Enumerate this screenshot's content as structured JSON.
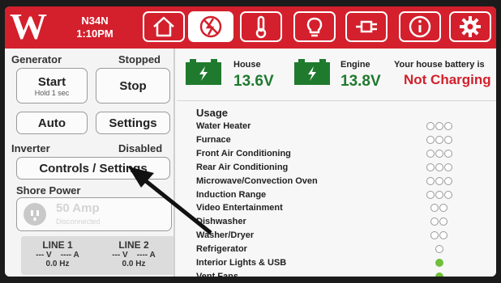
{
  "header": {
    "unit_id": "N34N",
    "time": "1:10PM",
    "nav": [
      {
        "icon": "home-icon"
      },
      {
        "icon": "power-icon"
      },
      {
        "icon": "thermometer-icon"
      },
      {
        "icon": "lightbulb-icon"
      },
      {
        "icon": "plug-icon"
      },
      {
        "icon": "info-icon"
      },
      {
        "icon": "gear-icon"
      }
    ],
    "active_nav": 1
  },
  "generator": {
    "label": "Generator",
    "status": "Stopped",
    "start_label": "Start",
    "start_hint": "Hold 1 sec",
    "stop_label": "Stop",
    "auto_label": "Auto",
    "settings_label": "Settings"
  },
  "inverter": {
    "label": "Inverter",
    "status": "Disabled",
    "controls_label": "Controls / Settings"
  },
  "shore_power": {
    "label": "Shore Power",
    "amps": "50 Amp",
    "status": "Disconnected"
  },
  "lines": [
    {
      "name": "LINE 1",
      "reading": "--- V    ---- A",
      "freq": "0.0 Hz"
    },
    {
      "name": "LINE 2",
      "reading": "--- V    ---- A",
      "freq": "0.0 Hz"
    }
  ],
  "batteries": {
    "house_label": "House",
    "house_voltage": "13.6V",
    "engine_label": "Engine",
    "engine_voltage": "13.8V",
    "message": "Your house battery is",
    "charge_status": "Not Charging",
    "accent_color": "#d3202c",
    "battery_color": "#1f7a2e"
  },
  "usage": {
    "title": "Usage",
    "items": [
      {
        "name": "Water Heater",
        "levels": 3,
        "active": 0
      },
      {
        "name": "Furnace",
        "levels": 3,
        "active": 0
      },
      {
        "name": "Front Air Conditioning",
        "levels": 3,
        "active": 0
      },
      {
        "name": "Rear Air Conditioning",
        "levels": 3,
        "active": 0
      },
      {
        "name": "Microwave/Convection Oven",
        "levels": 3,
        "active": 0
      },
      {
        "name": "Induction Range",
        "levels": 3,
        "active": 0
      },
      {
        "name": "Video Entertainment",
        "levels": 2,
        "active": 0
      },
      {
        "name": "Dishwasher",
        "levels": 2,
        "active": 0
      },
      {
        "name": "Washer/Dryer",
        "levels": 2,
        "active": 0
      },
      {
        "name": "Refrigerator",
        "levels": 1,
        "active": 0
      },
      {
        "name": "Interior Lights & USB",
        "levels": 1,
        "active": 1
      },
      {
        "name": "Vent Fans",
        "levels": 1,
        "active": 1
      }
    ]
  }
}
